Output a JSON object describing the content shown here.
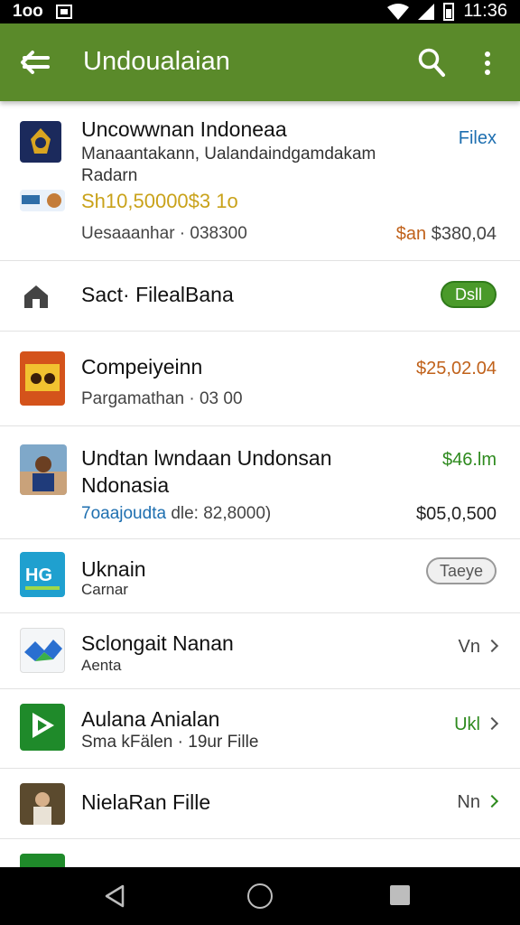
{
  "status_bar": {
    "left_text": "1oo",
    "time": "11:36"
  },
  "app_bar": {
    "title": "Undoualaian",
    "back_icon": "back-arrow-icon",
    "search_icon": "search-icon",
    "more_icon": "more-vert-icon"
  },
  "colors": {
    "appbar": "#5a8a2a",
    "blue": "#1e6fb0",
    "orange": "#c0611a",
    "green": "#2e8a1e",
    "gold": "#c9a21a"
  },
  "rows": [
    {
      "title": "Uncowwnan Indoneaa",
      "subtitle": "Manaantakann, Ualandaindgamdakam",
      "subtitle2": "Radarn",
      "price_line": "Sh10,50000$3 1o",
      "meta_left": "Uesaaanhar · 038300",
      "action": "Filex",
      "meta_right_a": "$an",
      "meta_right_b": "$380,04"
    },
    {
      "title": "Sact· FilealBana",
      "action": "Dsll"
    },
    {
      "title": "Compeiyeinn",
      "meta": "Pargamathan · 03 00",
      "price": "$25,02.04"
    },
    {
      "title": "Undtan lwndaan Undonsan",
      "title2": "Ndonasia",
      "meta_blue": "7oaajoudta",
      "meta_rest": "dle: 82,8000)",
      "price": "$46.lm",
      "price2": "$05,0,500"
    },
    {
      "title": "Uknain",
      "subtitle": "Carnar",
      "action": "Taeye"
    },
    {
      "title": "Sclongait Nanan",
      "subtitle": "Aenta",
      "right_text": "Vn"
    },
    {
      "title": "Aulana Anialan",
      "subtitle": "Sma kFälen · 19ur Fille",
      "right_text": "Ukl"
    },
    {
      "title": "NielaRan Fille",
      "right_text": "Nn"
    }
  ],
  "nav_bar": {
    "back": "nav-back-icon",
    "home": "nav-home-icon",
    "recent": "nav-recent-icon"
  }
}
